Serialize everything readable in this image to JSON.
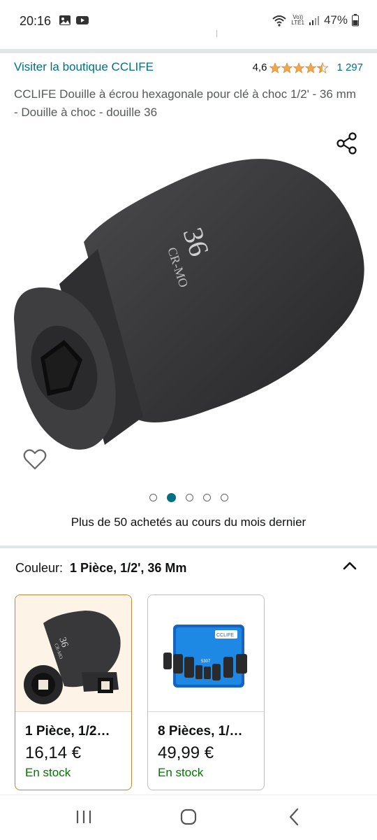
{
  "status_bar": {
    "time": "20:16",
    "volte_top": "Vo))",
    "volte_bottom": "LTE1",
    "battery": "47%",
    "icons": [
      "gallery-icon",
      "youtube-icon",
      "wifi-icon",
      "signal-icon",
      "battery-icon"
    ]
  },
  "header": {
    "store_link": "Visiter la boutique CCLIFE",
    "rating_value": "4,6",
    "rating_stars": 4.5,
    "rating_count": "1 297"
  },
  "product": {
    "title": "CCLIFE Douille à écrou hexagonale pour clé à choc 1/2' - 36 mm - Douille à choc - douille 36",
    "image_marking_size": "36",
    "image_marking_material": "CR-MO",
    "image_count": 5,
    "active_image_index": 1,
    "bought_text": "Plus de 50 achetés au cours du mois dernier"
  },
  "variation": {
    "label": "Couleur:",
    "selected": "1 Pièce, 1/2', 36 Mm"
  },
  "variants": [
    {
      "name": "1 Pièce, 1/2…",
      "price": "16,14 €",
      "stock": "En stock",
      "selected": true,
      "thumb_marking": "36",
      "thumb_material": "CR-MO"
    },
    {
      "name": "8 Pièces, 1/…",
      "price": "49,99 €",
      "stock": "En stock",
      "selected": false,
      "thumb_brand": "CCLIFE",
      "thumb_model": "5307"
    }
  ],
  "colors": {
    "link": "#007185",
    "star": "#f3a847",
    "in_stock": "#007600",
    "selected_border": "#c0873b",
    "selected_bg": "#fdf4e7"
  }
}
